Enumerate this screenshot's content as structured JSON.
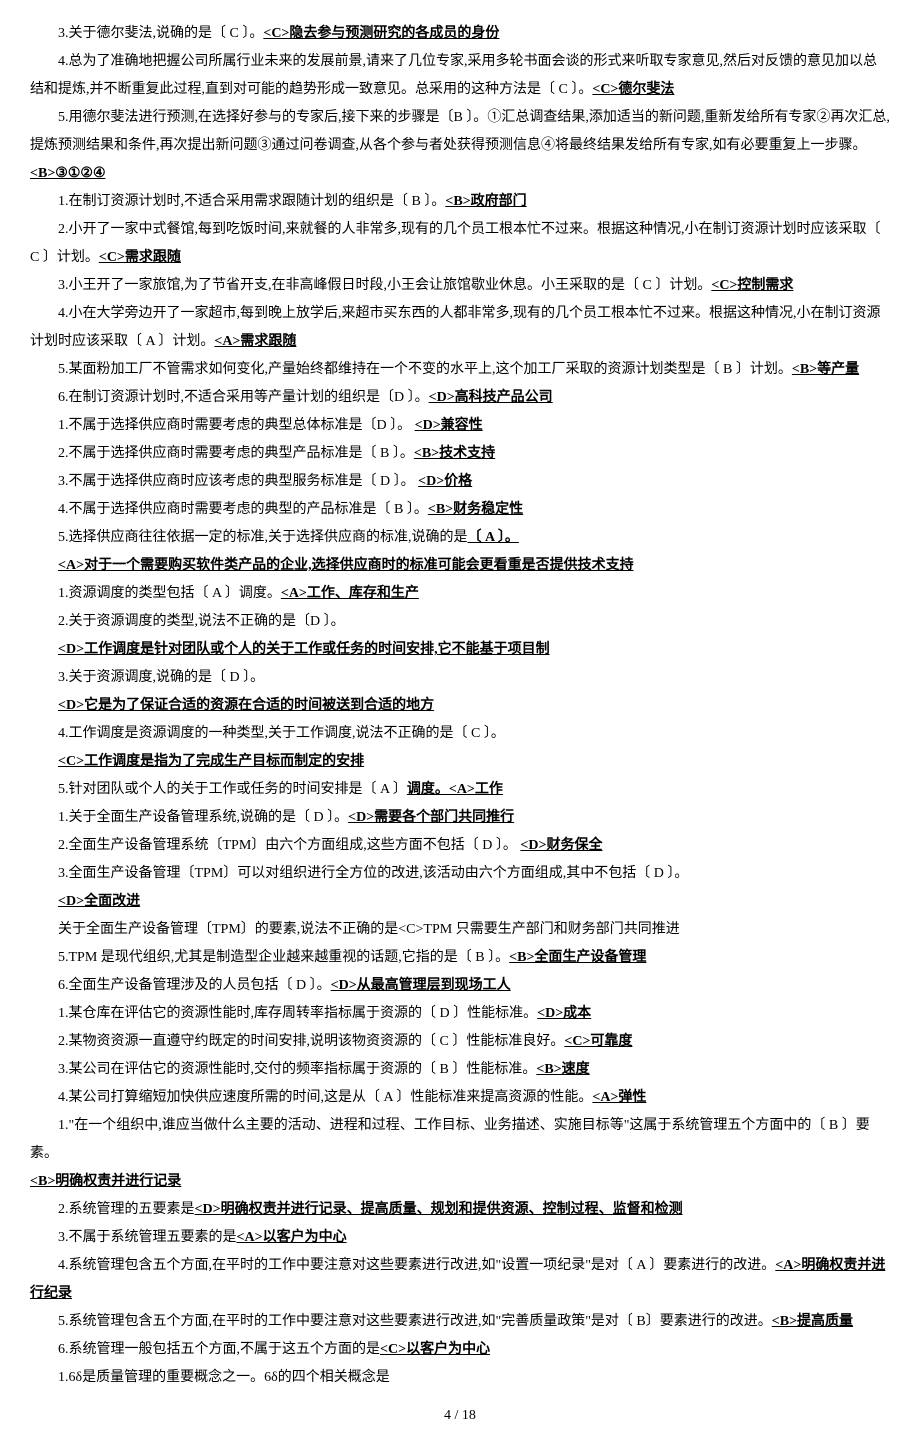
{
  "lines": [
    {
      "cls": "line",
      "parts": [
        {
          "t": "3.关于德尔斐法,说确的是〔 C 〕。"
        },
        {
          "t": "<C>隐去参与预测研究的各成员的身份",
          "u": true
        }
      ]
    },
    {
      "cls": "line",
      "parts": [
        {
          "t": "4.总为了准确地把握公司所属行业未来的发展前景,请来了几位专家,采用多轮书面会谈的形式来听取专家意见,然后对反馈的意见加以总结和提炼,并不断重复此过程,直到对可能的趋势形成一致意见。总采用的这种方法是〔 C 〕。"
        },
        {
          "t": "<C>德尔斐法",
          "u": true
        }
      ]
    },
    {
      "cls": "line",
      "parts": [
        {
          "t": "5.用德尔斐法进行预测,在选择好参与的专家后,接下来的步骤是〔B  〕。①汇总调查结果,添加适当的新问题,重新发给所有专家②再次汇总,提炼预测结果和条件,再次提出新问题③通过问卷调查,从各个参与者处获得预测信息④将最终结果发给所有专家,如有必要重复上一步骤。"
        }
      ]
    },
    {
      "cls": "noindent",
      "parts": [
        {
          "t": "<B>③①②④",
          "u": true
        }
      ]
    },
    {
      "cls": "line",
      "parts": [
        {
          "t": "1.在制订资源计划时,不适合采用需求跟随计划的组织是〔 B 〕。"
        },
        {
          "t": "<B>政府部门",
          "u": true
        }
      ]
    },
    {
      "cls": "line",
      "parts": [
        {
          "t": "2.小开了一家中式餐馆,每到吃饭时间,来就餐的人非常多,现有的几个员工根本忙不过来。根据这种情况,小在制订资源计划时应该采取〔  C 〕计划。"
        },
        {
          "t": "<C>需求跟随   ",
          "u": true
        }
      ]
    },
    {
      "cls": "line",
      "parts": [
        {
          "t": "3.小王开了一家旅馆,为了节省开支,在非高峰假日时段,小王会让旅馆歇业休息。小王采取的是〔 C  〕计划。"
        },
        {
          "t": "<C>控制需求 ",
          "u": true
        }
      ]
    },
    {
      "cls": "line",
      "parts": [
        {
          "t": " "
        }
      ]
    },
    {
      "cls": "line",
      "parts": [
        {
          "t": "4.小在大学旁边开了一家超市,每到晚上放学后,来超市买东西的人都非常多,现有的几个员工根本忙不过来。根据这种情况,小在制订资源计划时应该采取〔 A  〕计划。"
        },
        {
          "t": "<A>需求跟随 ",
          "u": true
        }
      ]
    },
    {
      "cls": "line",
      "parts": [
        {
          "t": "5.某面粉加工厂不管需求如何变化,产量始终都维持在一个不变的水平上,这个加工厂采取的资源计划类型是〔  B 〕计划。"
        },
        {
          "t": "<B>等产量",
          "u": true
        }
      ]
    },
    {
      "cls": "line",
      "parts": [
        {
          "t": "6.在制订资源计划时,不适合采用等产量计划的组织是〔D  〕。"
        },
        {
          "t": "<D>高科技产品公司",
          "u": true
        }
      ]
    },
    {
      "cls": "line",
      "parts": [
        {
          "t": "1.不属于选择供应商时需要考虑的典型总体标准是〔D  〕。 "
        },
        {
          "t": "<D>兼容性",
          "u": true
        }
      ]
    },
    {
      "cls": "line",
      "parts": [
        {
          "t": "2.不属于选择供应商时需要考虑的典型产品标准是〔 B 〕。"
        },
        {
          "t": "<B>技术支持",
          "u": true
        }
      ]
    },
    {
      "cls": "line",
      "parts": [
        {
          "t": "3.不属于选择供应商时应该考虑的典型服务标准是〔 D 〕。 "
        },
        {
          "t": "<D>价格",
          "u": true
        }
      ]
    },
    {
      "cls": "line",
      "parts": [
        {
          "t": "4.不属于选择供应商时需要考虑的典型的产品标准是〔 B 〕。"
        },
        {
          "t": "<B>财务稳定性",
          "u": true
        }
      ]
    },
    {
      "cls": "line",
      "parts": [
        {
          "t": "5.选择供应商往往依据一定的标准,关于选择供应商的标准,说确的是"
        },
        {
          "t": "〔 A 〕。",
          "u": true
        }
      ]
    },
    {
      "cls": "line",
      "parts": [
        {
          "t": "<A>对于一个需要购买软件类产品的企业,选择供应商时的标准可能会更看重是否提供技术支持",
          "u": true
        }
      ]
    },
    {
      "cls": "line",
      "parts": [
        {
          "t": "1.资源调度的类型包括〔 A  〕调度。"
        },
        {
          "t": "<A>工作、库存和生产",
          "u": true
        }
      ]
    },
    {
      "cls": "line",
      "parts": [
        {
          "t": "2.关于资源调度的类型,说法不正确的是〔D  〕。"
        }
      ]
    },
    {
      "cls": "line",
      "parts": [
        {
          "t": " <D>工作调度是针对团队或个人的关于工作或任务的时间安排,它不能基于项目制",
          "u": true
        }
      ]
    },
    {
      "cls": "line",
      "parts": [
        {
          "t": "3.关于资源调度,说确的是〔 D 〕。"
        }
      ]
    },
    {
      "cls": "line",
      "parts": [
        {
          "t": "<D>它是为了保证合适的资源在合适的时间被送到合适的地方",
          "u": true
        }
      ]
    },
    {
      "cls": "line",
      "parts": [
        {
          "t": "4.工作调度是资源调度的一种类型,关于工作调度,说法不正确的是〔 C 〕。"
        }
      ]
    },
    {
      "cls": "line",
      "parts": [
        {
          "t": "<C>工作调度是指为了完成生产目标而制定的安排 ",
          "u": true
        }
      ]
    },
    {
      "cls": "line",
      "parts": [
        {
          "t": "5.针对团队或个人的关于工作或任务的时间安排是〔  A 〕"
        },
        {
          "t": "调度。<A>工作 ",
          "u": true
        }
      ]
    },
    {
      "cls": "line",
      "parts": [
        {
          "t": "1.关于全面生产设备管理系统,说确的是〔 D 〕。"
        },
        {
          "t": "<D>需要各个部门共同推行",
          "u": true
        }
      ]
    },
    {
      "cls": "line",
      "parts": [
        {
          "t": "2.全面生产设备管理系统〔TPM〕由六个方面组成,这些方面不包括〔 D 〕。 "
        },
        {
          "t": "<D>财务保全",
          "u": true
        }
      ]
    },
    {
      "cls": "line",
      "parts": [
        {
          "t": "3.全面生产设备管理〔TPM〕可以对组织进行全方位的改进,该活动由六个方面组成,其中不包括〔  D 〕。"
        }
      ]
    },
    {
      "cls": "line",
      "parts": [
        {
          "t": "<D>全面改进",
          "u": true
        }
      ]
    },
    {
      "cls": "line",
      "parts": [
        {
          "t": "关于全面生产设备管理〔TPM〕的要素,说法不正确的是<C>TPM 只需要生产部门和财务部门共同推进"
        }
      ]
    },
    {
      "cls": "line",
      "parts": [
        {
          "t": "5.TPM 是现代组织,尤其是制造型企业越来越重视的话题,它指的是〔 B 〕。"
        },
        {
          "t": "<B>全面生产设备管理",
          "u": true
        }
      ]
    },
    {
      "cls": "line",
      "parts": [
        {
          "t": "6.全面生产设备管理涉及的人员包括〔 D 〕。"
        },
        {
          "t": "<D>从最高管理层到现场工人",
          "u": true
        }
      ]
    },
    {
      "cls": "line",
      "parts": [
        {
          "t": "1.某仓库在评估它的资源性能时,库存周转率指标属于资源的〔  D 〕性能标准。"
        },
        {
          "t": "<D>成本",
          "u": true
        }
      ]
    },
    {
      "cls": "line",
      "parts": [
        {
          "t": "2.某物资资源一直遵守约既定的时间安排,说明该物资资源的〔  C 〕性能标准良好。"
        },
        {
          "t": "<C>可靠度",
          "u": true
        }
      ]
    },
    {
      "cls": "line",
      "parts": [
        {
          "t": "3.某公司在评估它的资源性能时,交付的频率指标属于资源的〔 B  〕性能标准。"
        },
        {
          "t": "<B>速度",
          "u": true
        }
      ]
    },
    {
      "cls": "line",
      "parts": [
        {
          "t": "4.某公司打算缩短加快供应速度所需的时间,这是从〔 A  〕性能标准来提高资源的性能。"
        },
        {
          "t": "<A>弹性  ",
          "u": true
        }
      ]
    },
    {
      "cls": "line",
      "parts": [
        {
          "t": "1.\"在一个组织中,谁应当做什么主要的活动、进程和过程、工作目标、业务描述、实施目标等\"这属于系统管理五个方面中的〔 B  〕要素。"
        }
      ]
    },
    {
      "cls": "noindent",
      "parts": [
        {
          "t": "<B>明确权责并进行记录",
          "u": true
        }
      ]
    },
    {
      "cls": "line",
      "parts": [
        {
          "t": "2.系统管理的五要素是"
        },
        {
          "t": "<D>明确权责并进行记录、提高质量、规划和提供资源、控制过程、监督和检测",
          "u": true
        }
      ]
    },
    {
      "cls": "line",
      "parts": [
        {
          "t": "3.不属于系统管理五要素的是"
        },
        {
          "t": "<A>以客户为中心 ",
          "u": true
        }
      ]
    },
    {
      "cls": "line",
      "parts": [
        {
          "t": "4.系统管理包含五个方面,在平时的工作中要注意对这些要素进行改进,如\"设置一项纪录\"是对〔  A 〕要素进行的改进。"
        },
        {
          "t": "<A>明确权责并进行纪录",
          "u": true
        }
      ]
    },
    {
      "cls": "line",
      "parts": [
        {
          "t": "5.系统管理包含五个方面,在平时的工作中要注意对这些要素进行改进,如\"完善质量政策\"是对〔  B〕要素进行的改进。"
        },
        {
          "t": "<B>提高质量",
          "u": true
        }
      ]
    },
    {
      "cls": "line",
      "parts": [
        {
          "t": "6.系统管理一般包括五个方面,不属于这五个方面的是"
        },
        {
          "t": "<C>以客户为中心 ",
          "u": true
        }
      ]
    },
    {
      "cls": "line",
      "parts": [
        {
          "t": "1.6δ是质量管理的重要概念之一。6δ的四个相关概念是"
        }
      ]
    }
  ],
  "footer": "4 / 18"
}
